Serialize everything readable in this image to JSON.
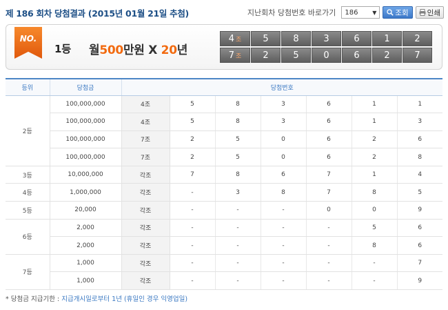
{
  "header": {
    "title": "제 186 회차 당첨결과 (2015년 01월 21일 추첨)",
    "prev_label": "지난회차 당첨번호 바로가기",
    "round_select": "186",
    "search_label": "조회",
    "print_label": "인쇄"
  },
  "winner": {
    "badge": "NO.",
    "rank": "1등",
    "prize_prefix": "월",
    "prize_amount": "500",
    "prize_unit": "만원 X ",
    "prize_years": "20",
    "prize_years_unit": "년",
    "rows": [
      {
        "group": "4",
        "group_unit": "조",
        "numbers": [
          "5",
          "8",
          "3",
          "6",
          "1",
          "2"
        ]
      },
      {
        "group": "7",
        "group_unit": "조",
        "numbers": [
          "2",
          "5",
          "0",
          "6",
          "2",
          "7"
        ]
      }
    ]
  },
  "table": {
    "headers": {
      "rank": "등위",
      "amount": "당첨금",
      "numbers": "당첨번호"
    },
    "ranks": [
      "2등",
      "3등",
      "4등",
      "5등",
      "6등",
      "7등"
    ],
    "rows": [
      {
        "amount": "100,000,000",
        "group": "4조",
        "nums": [
          "5",
          "8",
          "3",
          "6",
          "1",
          "1"
        ]
      },
      {
        "amount": "100,000,000",
        "group": "4조",
        "nums": [
          "5",
          "8",
          "3",
          "6",
          "1",
          "3"
        ]
      },
      {
        "amount": "100,000,000",
        "group": "7조",
        "nums": [
          "2",
          "5",
          "0",
          "6",
          "2",
          "6"
        ]
      },
      {
        "amount": "100,000,000",
        "group": "7조",
        "nums": [
          "2",
          "5",
          "0",
          "6",
          "2",
          "8"
        ]
      },
      {
        "amount": "10,000,000",
        "group": "각조",
        "nums": [
          "7",
          "8",
          "6",
          "7",
          "1",
          "4"
        ]
      },
      {
        "amount": "1,000,000",
        "group": "각조",
        "nums": [
          "-",
          "3",
          "8",
          "7",
          "8",
          "5"
        ]
      },
      {
        "amount": "20,000",
        "group": "각조",
        "nums": [
          "-",
          "-",
          "-",
          "0",
          "0",
          "9"
        ]
      },
      {
        "amount": "2,000",
        "group": "각조",
        "nums": [
          "-",
          "-",
          "-",
          "-",
          "5",
          "6"
        ]
      },
      {
        "amount": "2,000",
        "group": "각조",
        "nums": [
          "-",
          "-",
          "-",
          "-",
          "8",
          "6"
        ]
      },
      {
        "amount": "1,000",
        "group": "각조",
        "nums": [
          "-",
          "-",
          "-",
          "-",
          "-",
          "7"
        ]
      },
      {
        "amount": "1,000",
        "group": "각조",
        "nums": [
          "-",
          "-",
          "-",
          "-",
          "-",
          "9"
        ]
      }
    ]
  },
  "note": {
    "label": "* 당첨금 지급기한 : ",
    "text": "지급개시일로부터 1년 (휴일인 경우 익영업일)"
  },
  "colors": {
    "accent": "#3a78c2",
    "highlight": "#f26a0f",
    "title": "#1d4f86"
  }
}
